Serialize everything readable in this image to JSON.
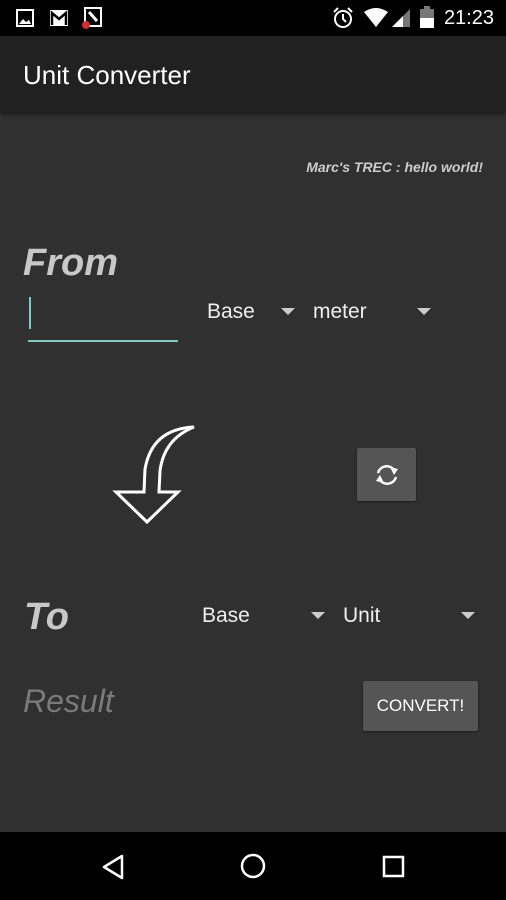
{
  "status_bar": {
    "time": "21:23",
    "icons": [
      "image-icon",
      "gmail-icon",
      "app-notification-icon",
      "alarm-icon",
      "wifi-icon",
      "signal-icon",
      "battery-icon"
    ]
  },
  "app_bar": {
    "title": "Unit Converter"
  },
  "tagline": "Marc's TREC : hello world!",
  "from": {
    "label": "From",
    "input_value": "",
    "category": "Base",
    "unit": "meter"
  },
  "to": {
    "label": "To",
    "category": "Base",
    "unit": "Unit"
  },
  "result_placeholder": "Result",
  "convert_label": "CONVERT!",
  "colors": {
    "background": "#303030",
    "app_bar": "#212121",
    "accent": "#80cbc4",
    "button": "#555555"
  }
}
